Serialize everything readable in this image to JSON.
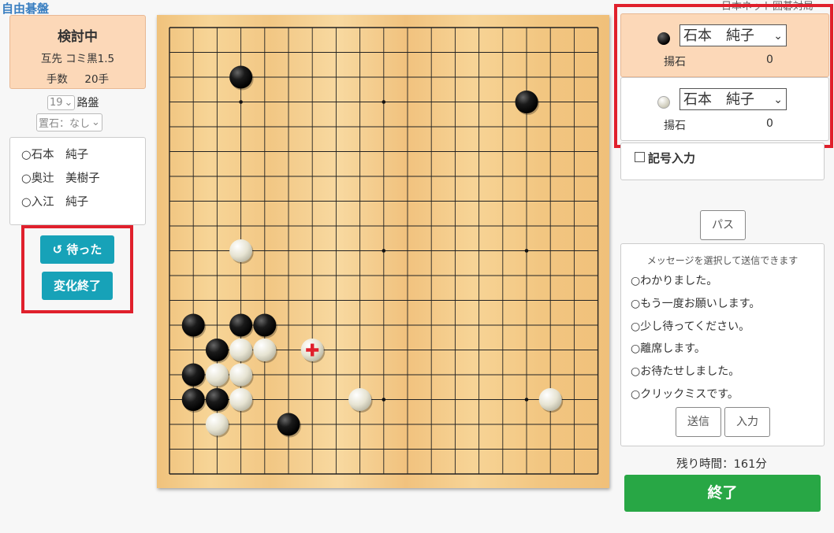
{
  "app_title": "自由碁盤",
  "top_right_title": "日本ネット囲碁対局",
  "status": {
    "title": "検討中",
    "rule_line": "互先  コミ黒1.5",
    "moves_label": "手数",
    "moves_value": "20手"
  },
  "board_size": {
    "value": "19",
    "suffix": "路盤"
  },
  "handicap": {
    "value": "置石：なし"
  },
  "players_list": [
    "○石本　純子",
    "○奥辻　美樹子",
    "○入江　純子"
  ],
  "buttons": {
    "undo": "待った",
    "end_variation": "変化終了",
    "pass": "パス",
    "send": "送信",
    "input": "入力",
    "finish": "終了"
  },
  "black_player": {
    "name": "石本　純子",
    "captures_label": "揚石",
    "captures": "0"
  },
  "white_player": {
    "name": "石本　純子",
    "captures_label": "揚石",
    "captures": "0"
  },
  "symbol_input_label": "記号入力",
  "messages": {
    "hint": "メッセージを選択して送信できます",
    "options": [
      "○わかりました。",
      "○もう一度お願いします。",
      "○少し待ってください。",
      "○離席します。",
      "○お待たせしました。",
      "○クリックミスです。"
    ]
  },
  "time_left": "残り時間：161分",
  "colors": {
    "teal": "#17a2b8",
    "green": "#28a745",
    "red_highlight": "#e0202c",
    "peach": "#fcd8b8",
    "board": "#f3cd8a"
  },
  "board": {
    "size": 19,
    "black_stones": [
      [
        3,
        2
      ],
      [
        15,
        3
      ],
      [
        1,
        12
      ],
      [
        3,
        12
      ],
      [
        4,
        12
      ],
      [
        2,
        13
      ],
      [
        1,
        14
      ],
      [
        1,
        15
      ],
      [
        2,
        15
      ],
      [
        5,
        16
      ]
    ],
    "white_stones": [
      [
        3,
        9
      ],
      [
        3,
        13
      ],
      [
        4,
        13
      ],
      [
        2,
        14
      ],
      [
        3,
        14
      ],
      [
        3,
        15
      ],
      [
        8,
        15
      ],
      [
        16,
        15
      ],
      [
        2,
        16
      ]
    ],
    "last_move": [
      6,
      13
    ],
    "last_move_marker": "red-cross"
  }
}
